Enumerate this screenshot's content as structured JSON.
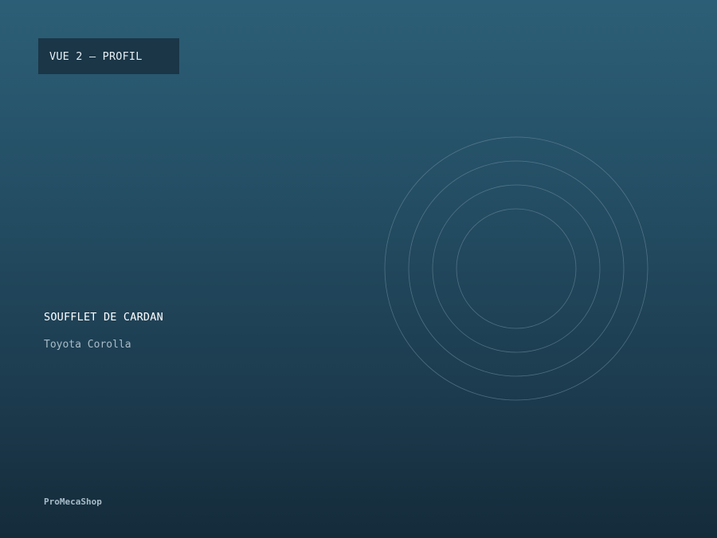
{
  "view_badge": {
    "label": "VUE 2 — PROFIL"
  },
  "product": {
    "title": "SOUFFLET DE CARDAN",
    "vehicle": "Toyota Corolla"
  },
  "brand": {
    "name": "ProMecaShop"
  },
  "graphic": {
    "icon": "concentric-rings-icon",
    "ring_color": "#6f8ea0"
  },
  "colors": {
    "background_top": "#2c5f77",
    "background_bottom": "#142b3a",
    "badge_background": "#1a3647"
  }
}
